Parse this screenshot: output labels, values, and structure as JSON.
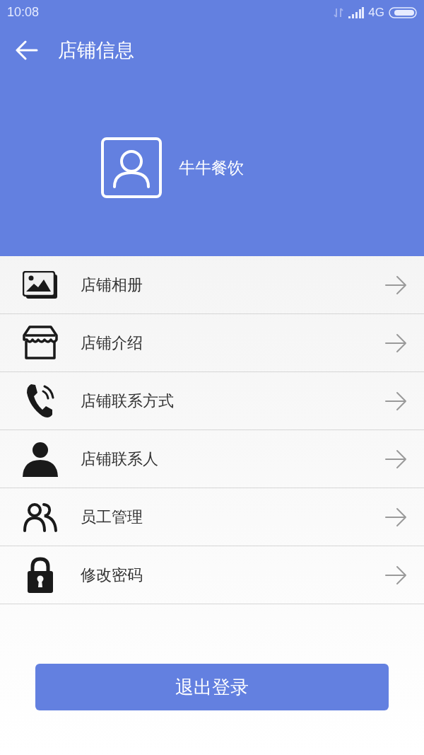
{
  "status_bar": {
    "time": "10:08",
    "network": "4G"
  },
  "toolbar": {
    "title": "店铺信息"
  },
  "profile": {
    "name": "牛牛餐饮"
  },
  "menu": [
    {
      "kind": "album",
      "label": "店铺相册"
    },
    {
      "kind": "shop",
      "label": "店铺介绍"
    },
    {
      "kind": "phone",
      "label": "店铺联系方式"
    },
    {
      "kind": "person",
      "label": "店铺联系人"
    },
    {
      "kind": "staff",
      "label": "员工管理"
    },
    {
      "kind": "lock",
      "label": "修改密码"
    }
  ],
  "logout_button": "退出登录"
}
